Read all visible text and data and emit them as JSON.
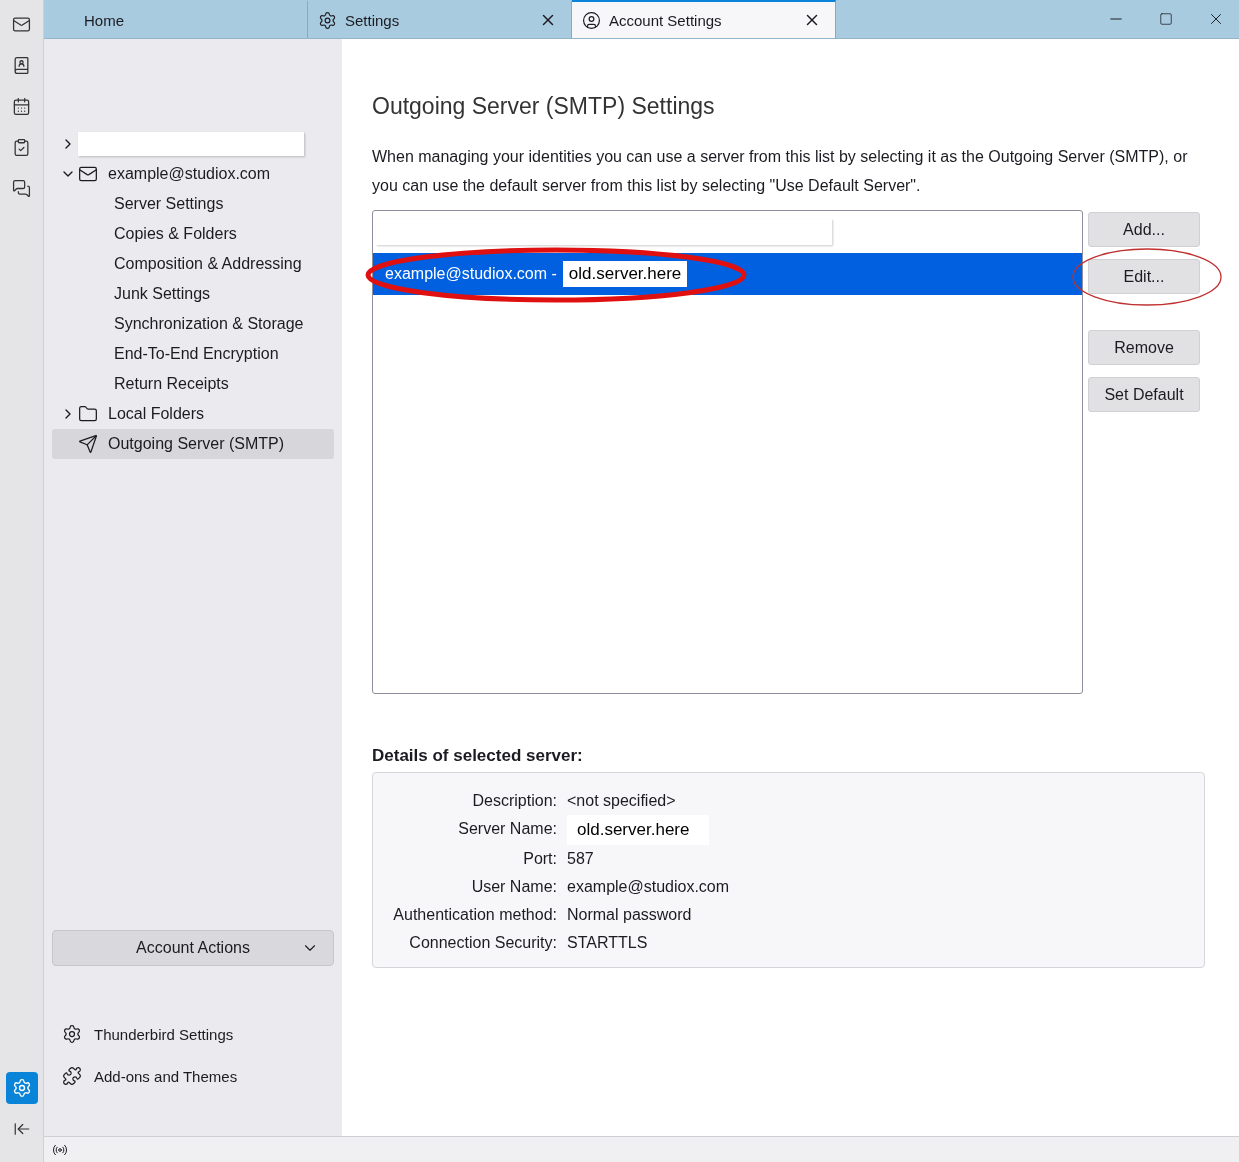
{
  "spaces_bar": {
    "items": [
      {
        "kind": "mail",
        "selected": false
      },
      {
        "kind": "contacts",
        "selected": false
      },
      {
        "kind": "calendar",
        "selected": false
      },
      {
        "kind": "tasks",
        "selected": false
      },
      {
        "kind": "chat",
        "selected": false
      }
    ],
    "settings": {
      "selected": true
    }
  },
  "tabs": [
    {
      "label": "Home",
      "selected": false
    },
    {
      "label": "Settings",
      "selected": false
    },
    {
      "label": "Account Settings",
      "selected": true
    }
  ],
  "sidebar": {
    "items": [
      {
        "kind": "redacted",
        "expanded": false,
        "selected": false
      },
      {
        "kind": "account",
        "label": "example@studiox.com",
        "expanded": true,
        "selected": false,
        "children": [
          {
            "label": "Server Settings",
            "selected": false
          },
          {
            "label": "Copies & Folders",
            "selected": false
          },
          {
            "label": "Composition & Addressing",
            "selected": false
          },
          {
            "label": "Junk Settings",
            "selected": false
          },
          {
            "label": "Synchronization & Storage",
            "selected": false
          },
          {
            "label": "End-To-End Encryption",
            "selected": false
          },
          {
            "label": "Return Receipts",
            "selected": false
          }
        ]
      },
      {
        "kind": "folder",
        "label": "Local Folders",
        "expanded": false,
        "selected": false
      },
      {
        "kind": "smtp",
        "label": "Outgoing Server (SMTP)",
        "selected": true
      }
    ],
    "account_actions": "Account Actions",
    "footer_links": [
      {
        "kind": "gear",
        "label": "Thunderbird Settings"
      },
      {
        "kind": "puzzle",
        "label": "Add-ons and Themes"
      }
    ]
  },
  "main": {
    "title": "Outgoing Server (SMTP) Settings",
    "description": "When managing your identities you can use a server from this list by selecting it as the Outgoing Server (SMTP), or you can use the default server from this list by selecting \"Use Default Server\".",
    "servers": [
      {
        "kind": "redacted"
      },
      {
        "kind": "server",
        "label": "example@studiox.com -",
        "server": "old.server.here",
        "selected": true,
        "circled": true
      }
    ],
    "buttons": [
      {
        "label": "Add...",
        "circled": false
      },
      {
        "label": "Edit...",
        "circled": true
      },
      {
        "label": "Remove",
        "circled": false
      },
      {
        "label": "Set Default",
        "circled": false
      }
    ],
    "details_title": "Details of selected server:",
    "details": [
      {
        "kind": "plain",
        "label": "Description:",
        "value": "<not specified>"
      },
      {
        "kind": "redacted",
        "label": "Server Name:",
        "value": "old.server.here"
      },
      {
        "kind": "plain",
        "label": "Port:",
        "value": "587"
      },
      {
        "kind": "plain",
        "label": "User Name:",
        "value": "example@studiox.com"
      },
      {
        "kind": "plain",
        "label": "Authentication method:",
        "value": "Normal password"
      },
      {
        "kind": "plain",
        "label": "Connection Security:",
        "value": "STARTTLS"
      }
    ]
  }
}
